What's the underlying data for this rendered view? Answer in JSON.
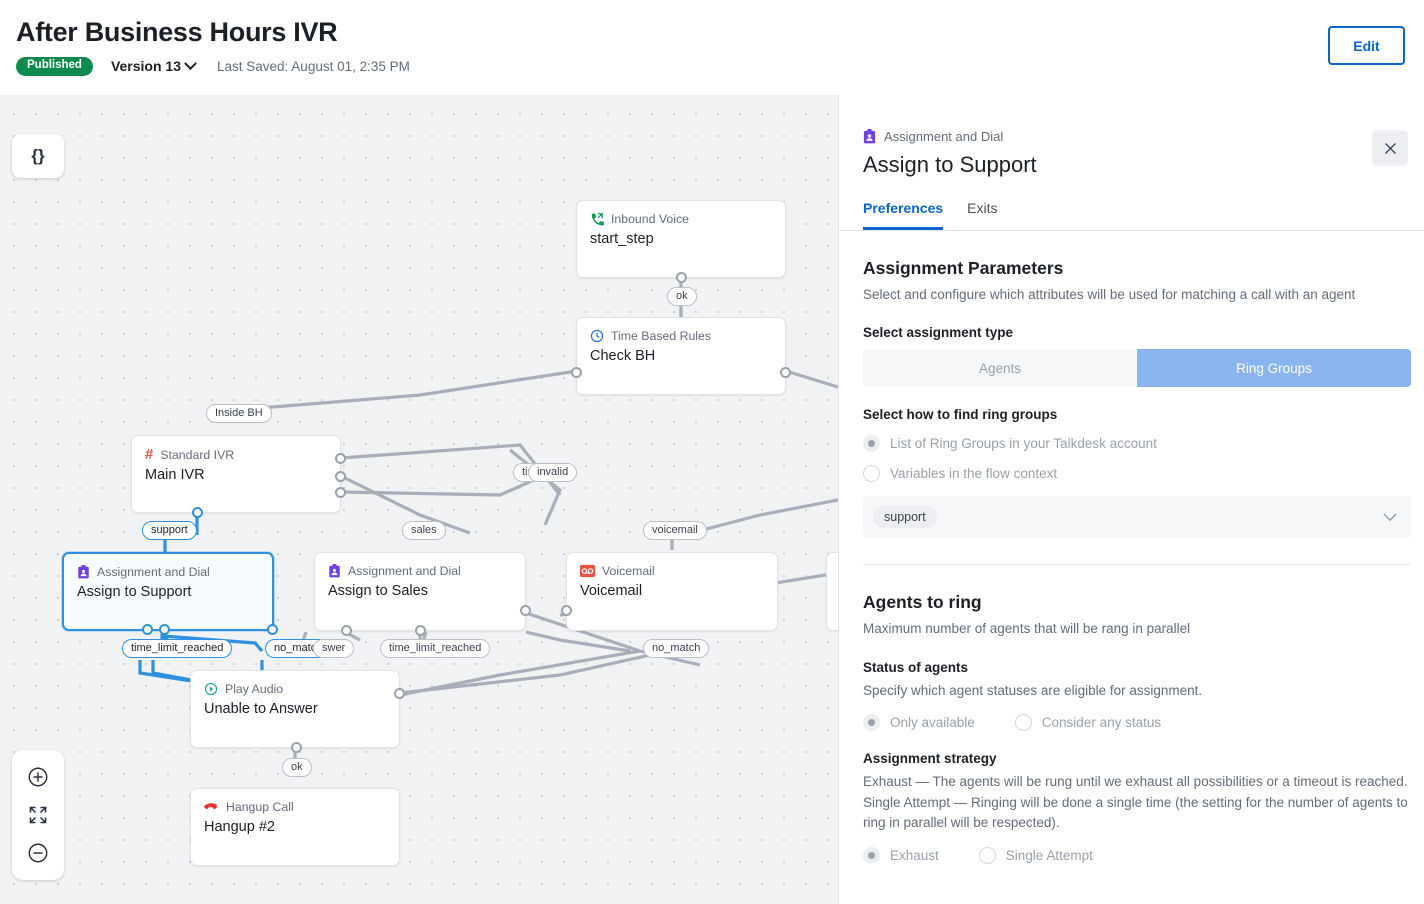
{
  "header": {
    "title": "After Business Hours IVR",
    "status_badge": "Published",
    "version": "Version 13",
    "last_saved": "Last Saved: August 01, 2:35 PM",
    "edit_label": "Edit",
    "accent_blue": "#0b63ce",
    "published_green": "#0f8a4f"
  },
  "canvas": {
    "json_button": "{}",
    "zoom_in": "zoom-in",
    "fit_screen": "fit-to-screen",
    "zoom_out": "zoom-out",
    "nodes": [
      {
        "type": "Inbound Voice",
        "title": "start_step",
        "icon": "inbound-call-icon",
        "selected": false
      },
      {
        "type": "Time Based Rules",
        "title": "Check BH",
        "icon": "clock-icon",
        "selected": false
      },
      {
        "type": "Standard IVR",
        "title": "Main IVR",
        "icon": "hash-icon",
        "selected": false
      },
      {
        "type": "Assignment and Dial",
        "title": "Assign to Support",
        "icon": "assignment-badge-icon",
        "selected": true
      },
      {
        "type": "Assignment and Dial",
        "title": "Assign to Sales",
        "icon": "assignment-badge-icon",
        "selected": false
      },
      {
        "type": "Voicemail",
        "title": "Voicemail",
        "icon": "voicemail-icon",
        "selected": false
      },
      {
        "type": "Play Audio",
        "title": "Unable to Answer",
        "icon": "play-audio-icon",
        "selected": false
      },
      {
        "type": "Hangup Call",
        "title": "Hangup #2",
        "icon": "hangup-icon",
        "selected": false
      }
    ],
    "edge_labels": [
      "ok",
      "Inside BH",
      "tim",
      "invalid",
      "support",
      "sales",
      "voicemail",
      "time_limit_reached",
      "no_match",
      "swer",
      "time_limit_reached",
      "no_match",
      "ok"
    ]
  },
  "panel": {
    "kicker": "Assignment and Dial",
    "title": "Assign to Support",
    "close": "close-icon",
    "tabs": [
      {
        "label": "Preferences",
        "active": true
      },
      {
        "label": "Exits",
        "active": false
      }
    ],
    "assignment_parameters": {
      "heading": "Assignment Parameters",
      "subtitle": "Select and configure which attributes will be used for matching a call with an agent",
      "type_label": "Select assignment type",
      "segment_agents": "Agents",
      "segment_ring_groups": "Ring Groups",
      "segment_selected": "Ring Groups",
      "find_label": "Select how to find ring groups",
      "option_list": "List of Ring Groups in your Talkdesk account",
      "option_variables": "Variables in the flow context",
      "selected_find_option": "List of Ring Groups in your Talkdesk account",
      "ring_group_value": "support"
    },
    "agents_to_ring": {
      "heading": "Agents to ring",
      "subtitle": "Maximum number of agents that will be rang in parallel",
      "status_label": "Status of agents",
      "status_sub": "Specify which agent statuses are eligible for assignment.",
      "status_option_a": "Only available",
      "status_option_b": "Consider any status",
      "status_selected": "Only available",
      "strategy_label": "Assignment strategy",
      "strategy_desc_1": "Exhaust — The agents will be rung until we exhaust all possibilities or a timeout is reached.",
      "strategy_desc_2": "Single Attempt — Ringing will be done a single time (the setting for the number of agents to ring in parallel will be respected).",
      "strategy_option_a": "Exhaust",
      "strategy_option_b": "Single Attempt",
      "strategy_selected": "Exhaust"
    }
  }
}
